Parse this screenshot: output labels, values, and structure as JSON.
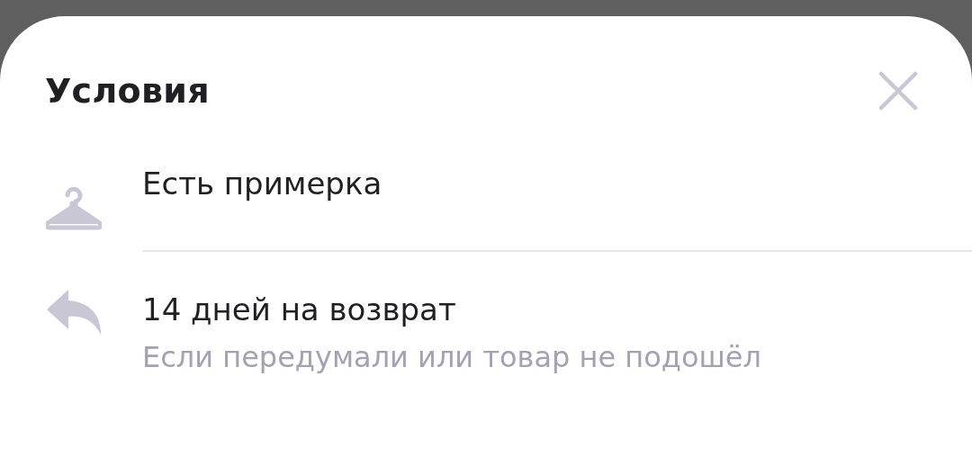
{
  "sheet": {
    "title": "Условия"
  },
  "items": [
    {
      "kind": "hanger",
      "title": "Есть примерка"
    },
    {
      "kind": "return",
      "title": "14 дней на возврат",
      "subtitle": "Если передумали или товар не подошёл"
    }
  ]
}
